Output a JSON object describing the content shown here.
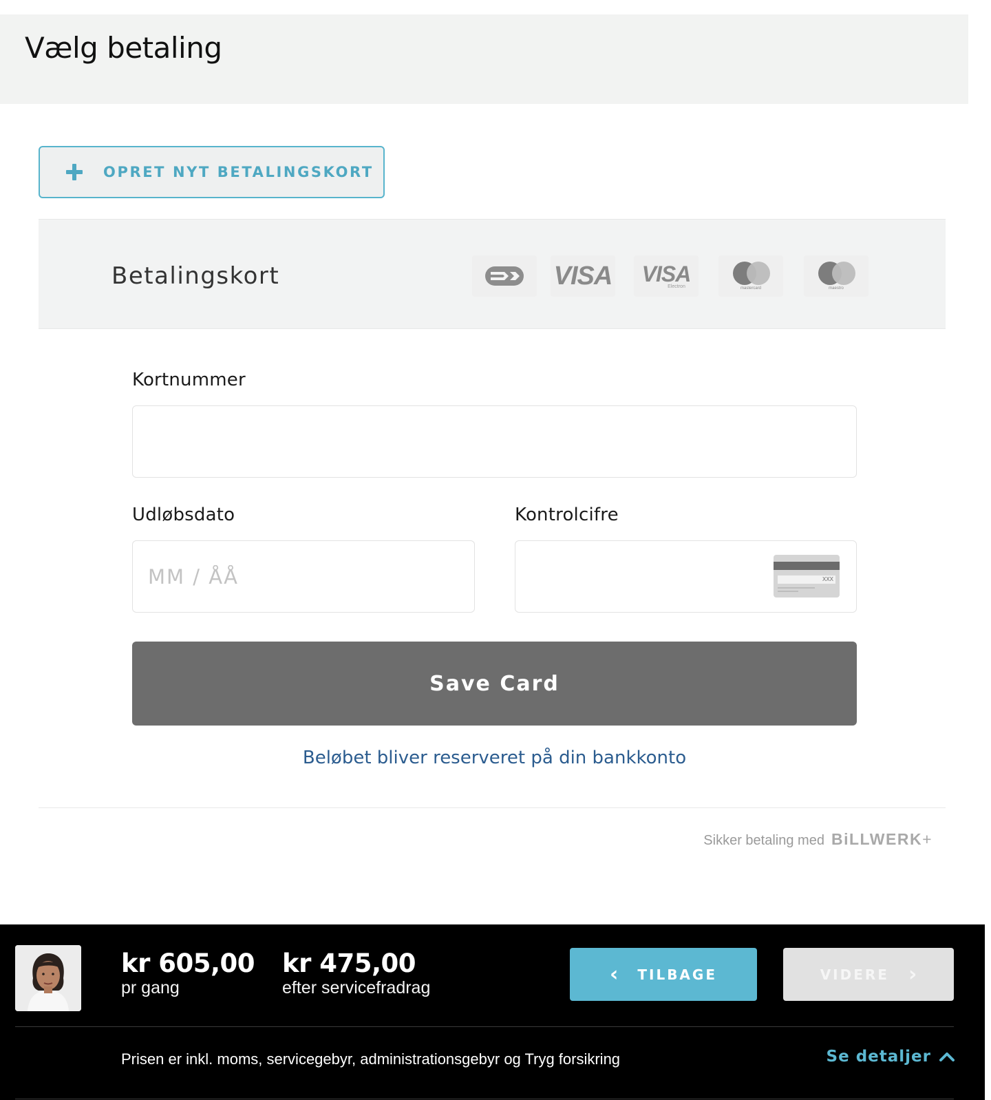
{
  "header": {
    "title": "Vælg betaling"
  },
  "add_card_button": {
    "label": "OPRET NYT BETALINGSKORT"
  },
  "payment_panel": {
    "title": "Betalingskort",
    "brands": {
      "dankort": "dankort-icon",
      "visa": "VISA",
      "visa_electron": "VISA",
      "visa_electron_sub": "Electron",
      "mastercard_sub": "mastercard",
      "maestro_sub": "maestro"
    }
  },
  "form": {
    "card_number_label": "Kortnummer",
    "card_number_value": "",
    "expiry_label": "Udløbsdato",
    "expiry_placeholder": "MM / ÅÅ",
    "cvc_label": "Kontrolcifre",
    "cvc_value": "",
    "cvc_icon_text": "XXX",
    "save_button": "Save Card",
    "reserve_note": "Beløbet bliver reserveret på din bankkonto"
  },
  "secure": {
    "text": "Sikker betaling med",
    "brand": "BiLLWERK",
    "brand_plus": "+"
  },
  "footer": {
    "price_1": {
      "amount": "kr 605,00",
      "sub": "pr gang"
    },
    "price_2": {
      "amount": "kr 475,00",
      "sub": "efter servicefradrag"
    },
    "back_button": "TILBAGE",
    "next_button": "VIDERE",
    "disclaimer": "Prisen er inkl. moms, servicegebyr, administrationsgebyr og Tryg forsikring",
    "details_link": "Se detaljer"
  },
  "colors": {
    "accent": "#5cb8d2",
    "save_button": "#6d6d6d",
    "link": "#2b5c8f"
  }
}
